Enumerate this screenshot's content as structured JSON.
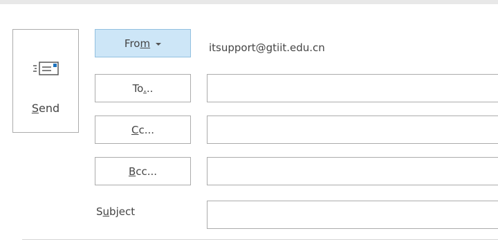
{
  "send": {
    "mnemonic": "S",
    "rest": "end",
    "icon": "envelope-send-icon"
  },
  "header_buttons": {
    "from_pre": "Fro",
    "from_mnemonic": "m",
    "to_pre": "To",
    "to_mnemonic": ".",
    "to_post": "..",
    "cc_mnemonic": "C",
    "cc_post": "c...",
    "bcc_mnemonic": "B",
    "bcc_post": "cc...",
    "from_caret_icon": "caret-down-icon"
  },
  "from_value": "itsupport@gtiit.edu.cn",
  "fields": {
    "to": "",
    "cc": "",
    "bcc": "",
    "subject": ""
  },
  "subject_label": {
    "pre": "S",
    "mnemonic": "u",
    "post": "bject"
  },
  "colors": {
    "from_button_bg": "#cde6f7",
    "border": "#ababab",
    "text": "#444444"
  }
}
